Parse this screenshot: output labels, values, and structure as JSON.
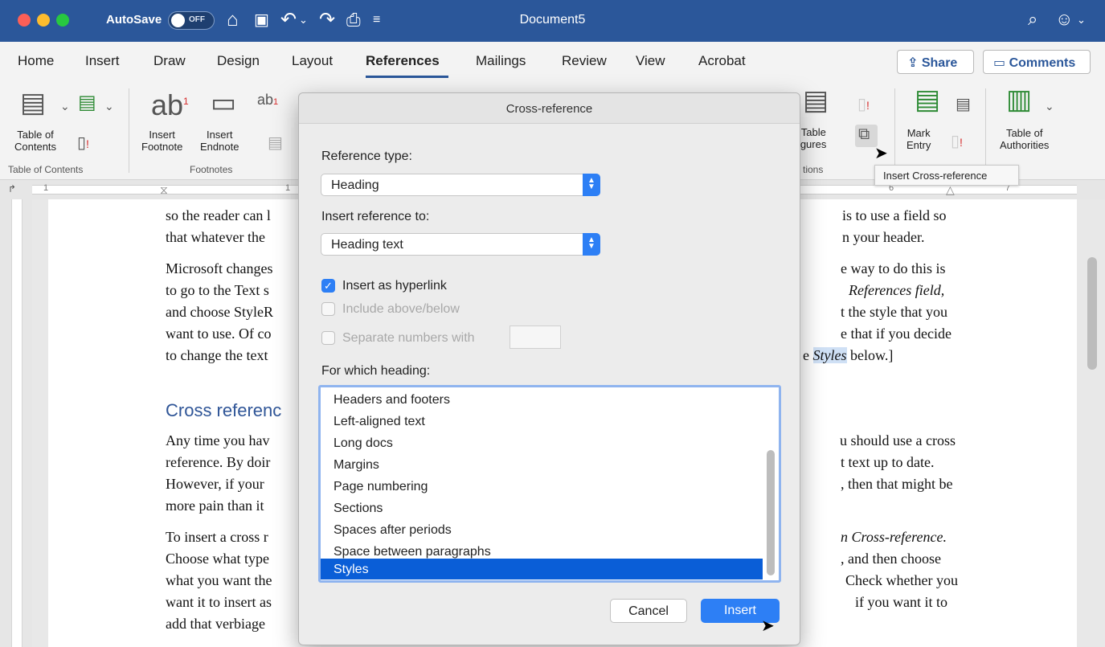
{
  "titlebar": {
    "autosave_label": "AutoSave",
    "autosave_state": "OFF",
    "document_title": "Document5"
  },
  "tabs": [
    {
      "label": "Home"
    },
    {
      "label": "Insert"
    },
    {
      "label": "Draw"
    },
    {
      "label": "Design"
    },
    {
      "label": "Layout"
    },
    {
      "label": "References",
      "active": true
    },
    {
      "label": "Mailings"
    },
    {
      "label": "Review"
    },
    {
      "label": "View"
    },
    {
      "label": "Acrobat"
    }
  ],
  "header_buttons": {
    "share": "Share",
    "comments": "Comments"
  },
  "ribbon": {
    "table_of_contents_label": "Table of\nContents",
    "insert_footnote_label": "Insert\nFootnote",
    "insert_endnote_label": "Insert\nEndnote",
    "insert_table_of_figures_label": "rt Table\nFigures",
    "mark_entry_label": "Mark\nEntry",
    "table_of_authorities_label": "Table of\nAuthorities",
    "groups": {
      "toc": "Table of Contents",
      "footnotes": "Footnotes",
      "captions": "tions"
    }
  },
  "tooltip": "Insert Cross-reference",
  "ruler_numbers": [
    "1",
    "1",
    "6",
    "7"
  ],
  "document": {
    "lines": [
      {
        "left": "so the reader can l",
        "right": "is to use a field so"
      },
      {
        "left": "that whatever the",
        "right": "n your header."
      },
      {
        "left": "Microsoft changes",
        "right": "e way to do this is"
      },
      {
        "left": "to go to the Text s",
        "right": "References field,"
      },
      {
        "left": "and choose StyleR",
        "right": "t the style that you"
      },
      {
        "left": "want to use. Of co",
        "right": "e that if you decide"
      },
      {
        "left": "to change the text",
        "right_pre": "e ",
        "right_hl": "Styles",
        "right_post": " below.]"
      },
      {
        "left": "Any time you hav",
        "right": "u should use a cross"
      },
      {
        "left": "reference. By doir",
        "right": "t text up to date."
      },
      {
        "left": "However, if your",
        "right": ", then that might be"
      },
      {
        "left": "more pain than it",
        "right": ""
      },
      {
        "left": "To insert a cross r",
        "right": "n Cross-reference."
      },
      {
        "left": "Choose what type",
        "right": ", and then choose"
      },
      {
        "left": "what you want the",
        "right": "Check whether you"
      },
      {
        "left": "want it to insert as",
        "right": "if you want it to"
      },
      {
        "left": "add that verbiage",
        "right": ""
      }
    ],
    "heading": "Cross referenc"
  },
  "dialog": {
    "title": "Cross-reference",
    "reference_type_label": "Reference type:",
    "reference_type_value": "Heading",
    "insert_reference_to_label": "Insert reference to:",
    "insert_reference_to_value": "Heading text",
    "insert_as_hyperlink": "Insert as hyperlink",
    "include_above_below": "Include above/below",
    "separate_numbers_with": "Separate numbers with",
    "for_which_heading_label": "For which heading:",
    "headings": [
      "Headers and footers",
      "Left-aligned text",
      "Long docs",
      "Margins",
      "Page numbering",
      "Sections",
      "Spaces after periods",
      "Space between paragraphs",
      "Styles"
    ],
    "selected_heading": "Styles",
    "cancel_label": "Cancel",
    "insert_label": "Insert"
  }
}
